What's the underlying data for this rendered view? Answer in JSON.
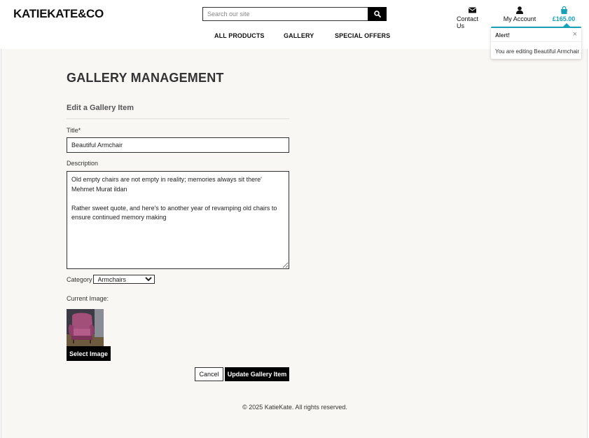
{
  "header": {
    "brand": "KATIEKATE&CO",
    "search_placeholder": "Search our site",
    "contact_label": "Contact Us",
    "account_label": "My Account",
    "bag_total": "£165.00",
    "accent_color": "#17a2b8"
  },
  "nav": {
    "items": [
      {
        "label": "ALL PRODUCTS"
      },
      {
        "label": "GALLERY"
      },
      {
        "label": "SPECIAL OFFERS"
      }
    ]
  },
  "alert": {
    "heading": "Alert!",
    "close": "×",
    "message": "You are editing Beautiful Armchair"
  },
  "page": {
    "title": "GALLERY MANAGEMENT",
    "subtitle": "Edit a Gallery Item"
  },
  "form": {
    "title_label": "Title*",
    "title_value": "Beautiful Armchair",
    "description_label": "Description",
    "description_value": "Old empty chairs are not empty in reality; memories always sit there' Mehmet Murat ildan\n\nRather sweet quote, and here's to another year of revamping old chairs to ensure continued memory making",
    "category_label": "Category",
    "category_value": "Armchairs",
    "current_image_label": "Current Image:",
    "select_image_label": "Select Image",
    "cancel_label": "Cancel",
    "submit_label": "Update Gallery Item"
  },
  "footer": {
    "copyright": "© 2025 KatieKate. All rights reserved."
  }
}
